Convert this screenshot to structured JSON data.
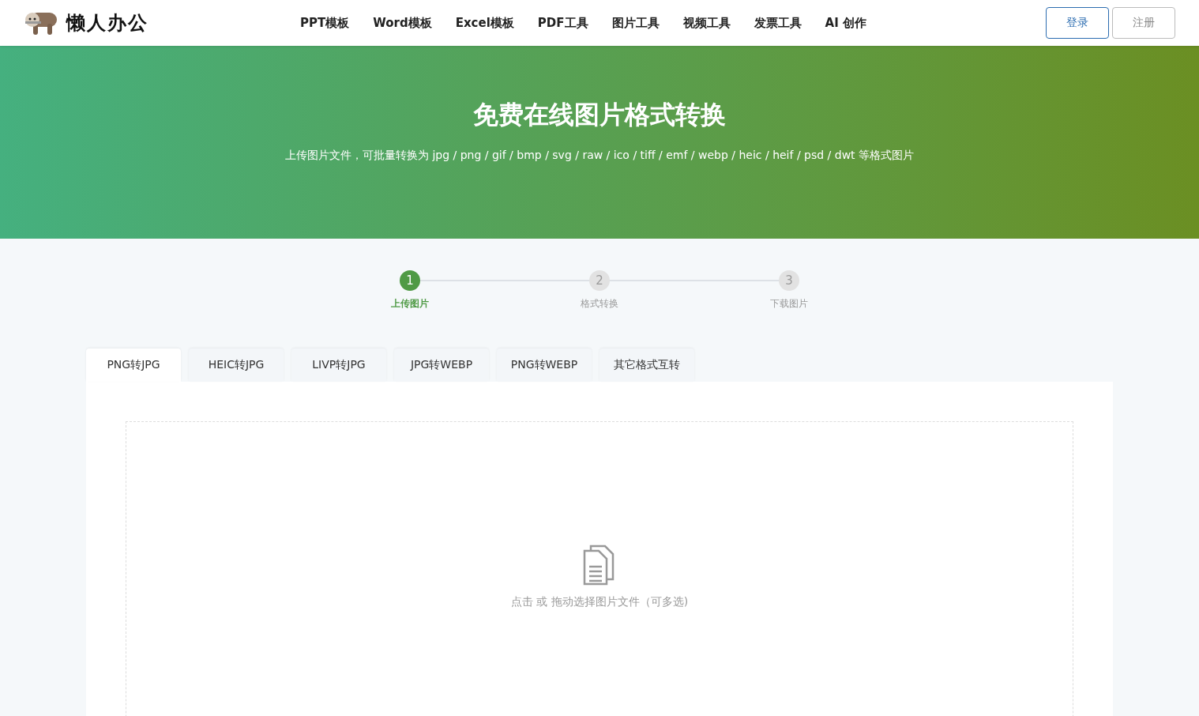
{
  "header": {
    "logo": "懒人办公",
    "nav": [
      {
        "label": "PPT模板"
      },
      {
        "label": "Word模板"
      },
      {
        "label": "Excel模板"
      },
      {
        "label": "PDF工具"
      },
      {
        "label": "图片工具"
      },
      {
        "label": "视频工具"
      },
      {
        "label": "发票工具"
      },
      {
        "label": "AI 创作"
      }
    ],
    "buttons": [
      {
        "label": "登录",
        "kind": "primary"
      },
      {
        "label": "注册",
        "kind": "plain"
      }
    ]
  },
  "hero": {
    "title": "免费在线图片格式转换",
    "subtitle": "上传图片文件，可批量转换为 jpg / png / gif / bmp / svg / raw / ico / tiff / emf / webp / heic / heif / psd / dwt 等格式图片"
  },
  "steps": [
    {
      "number": "1",
      "label": "上传图片",
      "selected": true
    },
    {
      "number": "2",
      "label": "格式转换",
      "selected": false
    },
    {
      "number": "3",
      "label": "下载图片",
      "selected": false
    }
  ],
  "tabs": [
    {
      "label": "PNG转JPG",
      "selected": true
    },
    {
      "label": "HEIC转JPG",
      "selected": false
    },
    {
      "label": "LIVP转JPG",
      "selected": false
    },
    {
      "label": "JPG转WEBP",
      "selected": false
    },
    {
      "label": "PNG转WEBP",
      "selected": false
    },
    {
      "label": "其它格式互转",
      "selected": false
    }
  ],
  "dropzone": {
    "hint": "点击 或 拖动选择图片文件（可多选)"
  }
}
